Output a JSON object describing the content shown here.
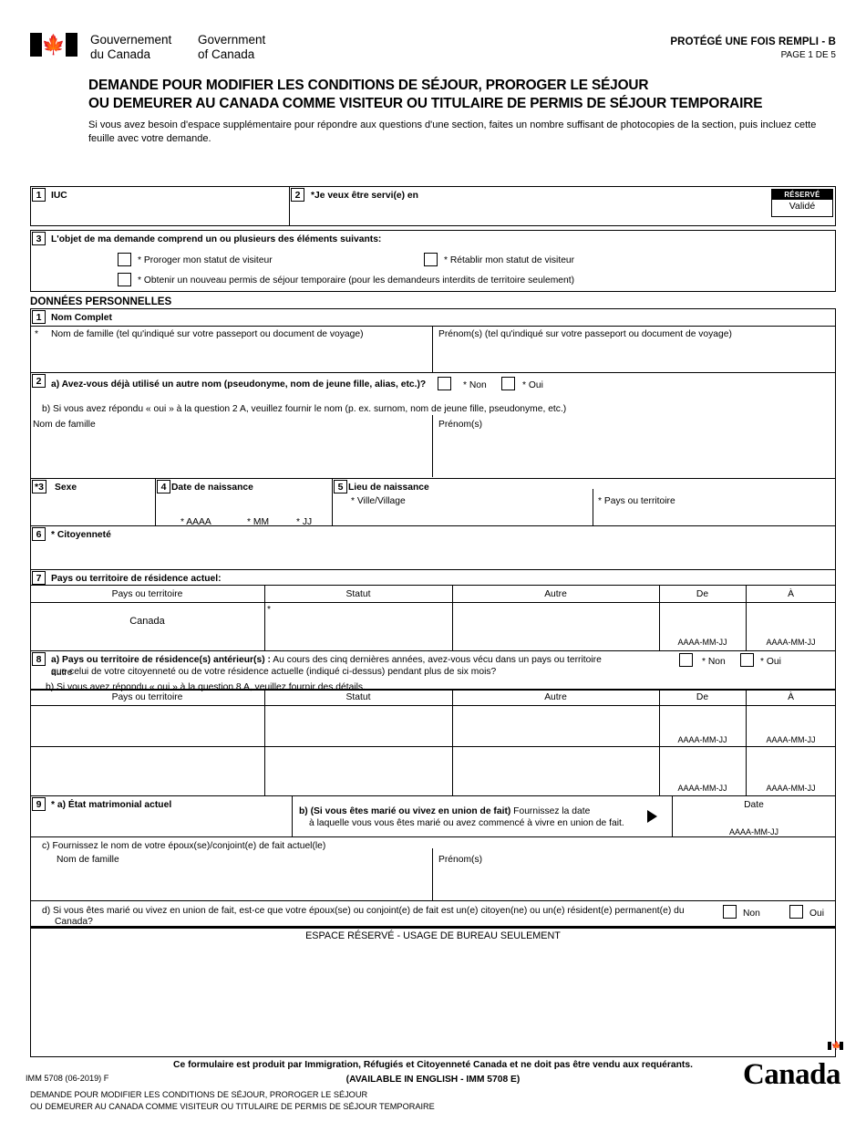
{
  "header": {
    "wordmark_fr_line1": "Gouvernement",
    "wordmark_fr_line2": "du Canada",
    "wordmark_en_line1": "Government",
    "wordmark_en_line2": "of Canada",
    "protected": "PROTÉGÉ UNE FOIS REMPLI - B",
    "page": "PAGE 1 DE 5",
    "title_line1": "DEMANDE POUR MODIFIER LES CONDITIONS DE SÉJOUR, PROROGER LE SÉJOUR",
    "title_line2": "OU DEMEURER AU CANADA COMME VISITEUR OU TITULAIRE DE PERMIS DE SÉJOUR TEMPORAIRE",
    "instructions": "Si vous avez besoin d'espace supplémentaire pour répondre aux questions d'une section, faites un nombre suffisant de photocopies de la section, puis incluez cette feuille avec votre demande."
  },
  "reserved": {
    "caption": "RÉSERVÉ",
    "value": "Validé"
  },
  "q1": {
    "num": "1",
    "label": "IUC"
  },
  "q2": {
    "num": "2",
    "label": "*Je veux être servi(e) en"
  },
  "q3": {
    "num": "3",
    "label": "L'objet de ma demande comprend un ou plusieurs des éléments suivants:",
    "opt1": "* Proroger mon statut de visiteur",
    "opt2": "* Rétablir mon statut de visiteur",
    "opt3": "* Obtenir un nouveau permis de séjour temporaire (pour les demandeurs interdits de territoire seulement)"
  },
  "personal": {
    "heading": "DONNÉES PERSONNELLES",
    "p1": {
      "num": "1",
      "label": "Nom Complet",
      "asterisk": "*",
      "family": "Nom de famille (tel qu'indiqué sur votre passeport ou document de voyage)",
      "given": "Prénom(s) (tel qu'indiqué sur votre passeport ou document de voyage)"
    },
    "p2": {
      "num": "2",
      "a": "a) Avez-vous déjà utilisé un autre nom (pseudonyme, nom de jeune fille, alias, etc.)?",
      "no": "* Non",
      "yes": "* Oui",
      "b": "b) Si vous avez répondu « oui » à la question 2 A, veuillez fournir le nom (p. ex. surnom, nom de jeune fille, pseudonyme, etc.)",
      "family": "Nom de famille",
      "given": "Prénom(s)"
    },
    "p3": {
      "num": "*3",
      "label": "Sexe"
    },
    "p4": {
      "num": "4",
      "label": "Date de naissance",
      "yyyy": "* AAAA",
      "mm": "* MM",
      "dd": "* JJ"
    },
    "p5": {
      "num": "5",
      "label": "Lieu de naissance",
      "city": "* Ville/Village",
      "country": "* Pays ou territoire"
    },
    "p6": {
      "num": "6",
      "label": "* Citoyenneté"
    },
    "p7": {
      "num": "7",
      "label": "Pays ou territoire de résidence actuel:",
      "columns": [
        "Pays ou territoire",
        "Statut",
        "Autre",
        "De",
        "À"
      ],
      "row_country": "Canada",
      "status_asterisk": "*",
      "date_hint_from": "AAAA-MM-JJ",
      "date_hint_to": "AAAA-MM-JJ"
    },
    "p8": {
      "num": "8",
      "a_line1_bold": "a) Pays ou territoire de résidence(s) antérieur(s) :",
      "a_line1_rest": " Au cours des cinq dernières années, avez-vous vécu dans un pays ou territoire autre",
      "a_line2": "que celui de votre citoyenneté ou de votre résidence actuelle (indiqué ci-dessus) pendant plus de six mois?",
      "no": "* Non",
      "yes": "* Oui",
      "b": "b)  Si vous avez répondu « oui » à la question 8 A, veuillez fournir des détails.",
      "columns": [
        "Pays ou territoire",
        "Statut",
        "Autre",
        "De",
        "À"
      ],
      "row1_from_hint": "AAAA-MM-JJ",
      "row1_to_hint": "AAAA-MM-JJ",
      "row2_from_hint": "AAAA-MM-JJ",
      "row2_to_hint": "AAAA-MM-JJ"
    },
    "p9": {
      "num": "9",
      "a": "* a) État  matrimonial actuel",
      "b_bold": "b) (Si vous êtes marié ou vivez en union de fait)",
      "b_rest": " Fournissez la date",
      "b_line2": "à laquelle vous vous êtes marié ou avez commencé à vivre en union de fait.",
      "date_label": "Date",
      "date_hint": "AAAA-MM-JJ",
      "c": "c) Fournissez le nom de votre époux(se)/conjoint(e) de fait actuel(le)",
      "c_family": "Nom de famille",
      "c_given": "Prénom(s)",
      "d_line1": "d) Si vous êtes marié ou vivez en union de fait, est-ce que votre époux(se) ou conjoint(e) de fait est un(e) citoyen(ne) ou un(e) résident(e) permanent(e) du",
      "d_line2": "Canada?",
      "d_no": "Non",
      "d_yes": "Oui"
    }
  },
  "office": {
    "heading": "ESPACE RÉSERVÉ - USAGE DE BUREAU SEULEMENT"
  },
  "footer": {
    "line1": "Ce formulaire est produit par Immigration, Réfugiés et Citoyenneté Canada et ne doit pas être vendu aux requérants.",
    "line2": "(AVAILABLE IN ENGLISH - IMM 5708 E)",
    "form_id": "IMM 5708 (06-2019) F",
    "sub1": "DEMANDE POUR MODIFIER LES CONDITIONS DE SÉJOUR, PROROGER LE SÉJOUR",
    "sub2": "OU DEMEURER AU CANADA COMME VISITEUR OU TITULAIRE DE PERMIS DE SÉJOUR TEMPORAIRE",
    "wordmark": "Canad"
  }
}
